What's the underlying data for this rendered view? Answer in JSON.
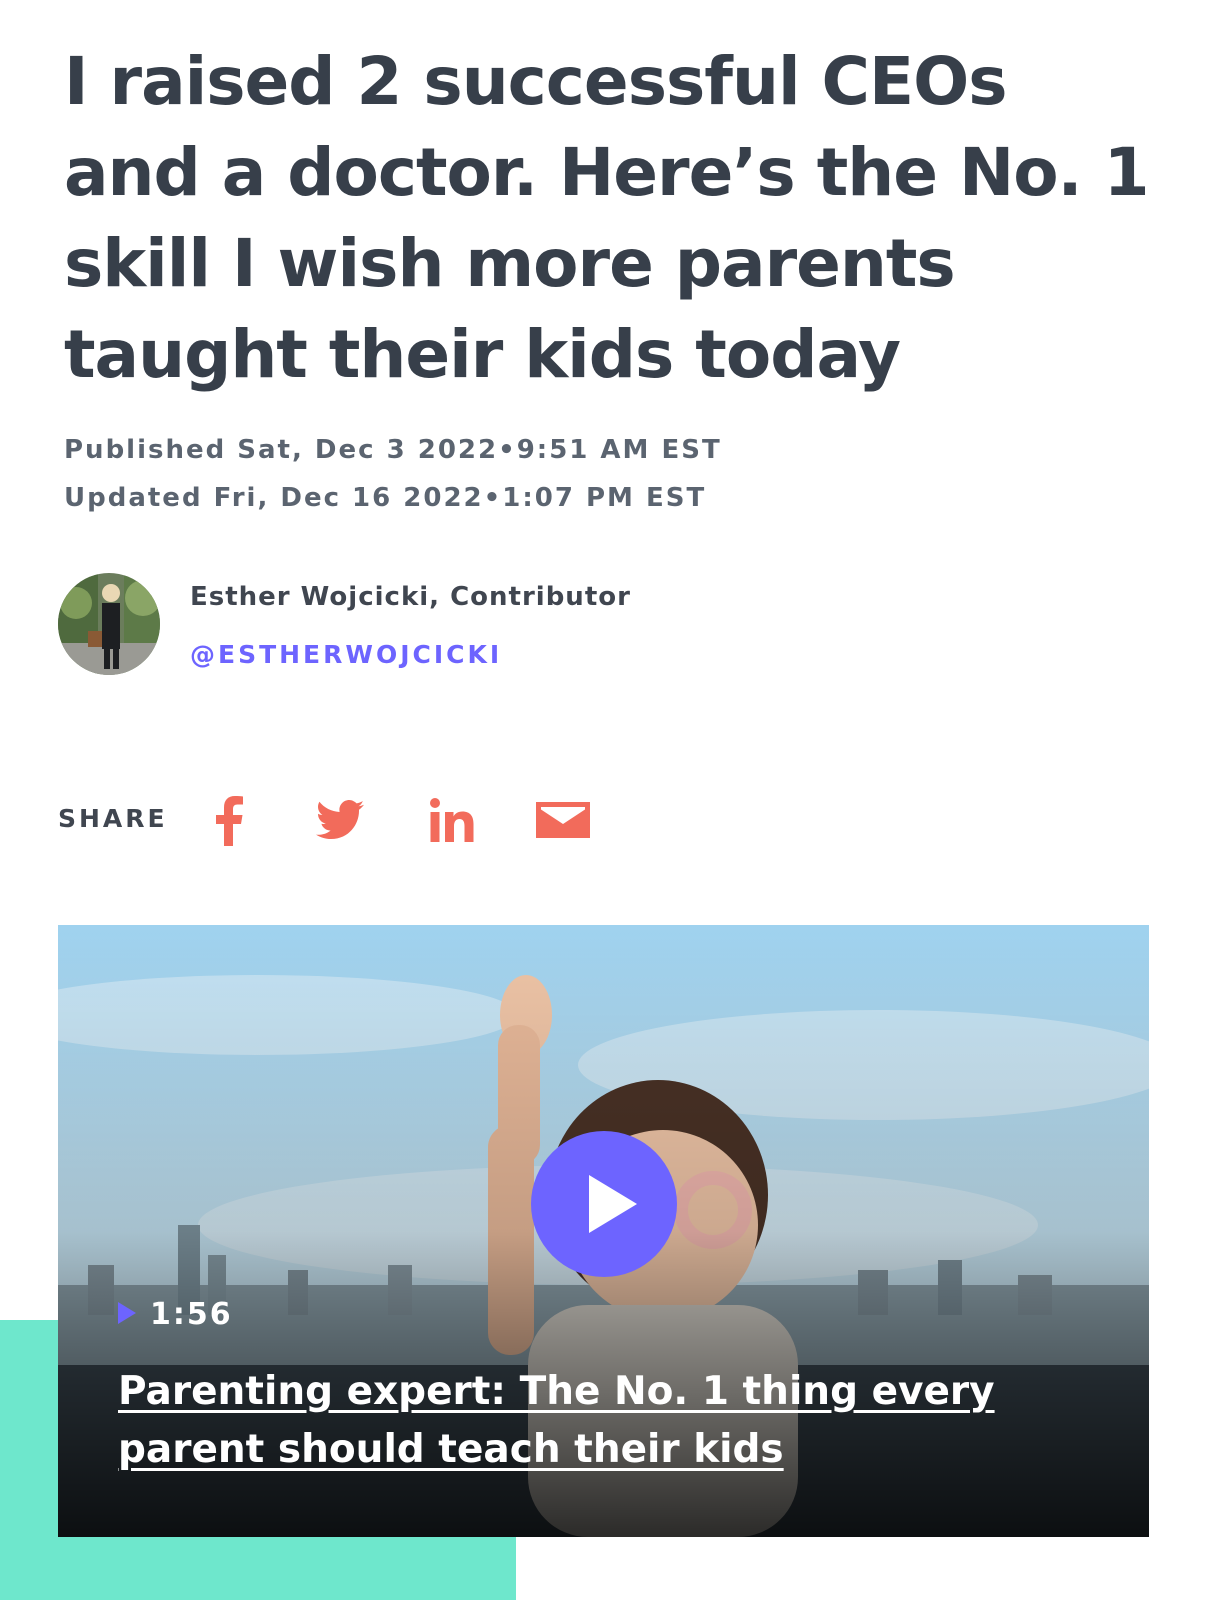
{
  "article": {
    "headline": "I raised 2 successful CEOs and a doctor. Here’s the No. 1 skill I wish more parents taught their kids today",
    "published": "Published Sat, Dec 3 2022•9:51 AM EST",
    "updated": "Updated Fri, Dec 16 2022•1:07 PM EST"
  },
  "author": {
    "name": "Esther Wojcicki, Contributor",
    "handle": "@ESTHERWOJCICKI"
  },
  "share": {
    "label": "SHARE",
    "icons": [
      "facebook-icon",
      "twitter-icon",
      "linkedin-icon",
      "email-icon"
    ]
  },
  "video": {
    "duration": "1:56",
    "title": "Parenting expert: The No. 1 thing every parent should teach their kids"
  },
  "colors": {
    "headline": "#373f4a",
    "handle": "#6d64ff",
    "share_icon": "#f26b5b",
    "play_button": "#6d64ff",
    "accent_block": "#6ee7cc"
  }
}
